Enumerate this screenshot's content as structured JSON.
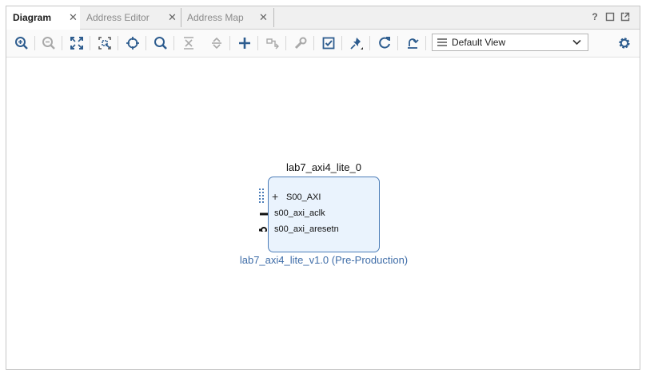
{
  "tabs": [
    {
      "label": "Diagram",
      "active": true
    },
    {
      "label": "Address Editor",
      "active": false
    },
    {
      "label": "Address Map",
      "active": false
    }
  ],
  "window_controls": {
    "help": "?"
  },
  "toolbar": {
    "icons": [
      "zoom-in-icon",
      "zoom-out-icon",
      "fit-view-icon",
      "fit-selection-icon",
      "center-icon",
      "search-icon",
      "collapse-all-icon",
      "expand-all-icon",
      "add-ip-icon",
      "make-connection-icon",
      "wrench-icon",
      "validate-icon",
      "pin-icon",
      "regenerate-icon",
      "optimize-routing-icon",
      "gear-icon"
    ],
    "view_select": "Default View"
  },
  "diagram": {
    "ip_instance_name": "lab7_axi4_lite_0",
    "ip_version": "lab7_axi4_lite_v1.0 (Pre-Production)",
    "ports": [
      {
        "name": "S00_AXI",
        "type": "interface"
      },
      {
        "name": "s00_axi_aclk",
        "type": "clock"
      },
      {
        "name": "s00_axi_aresetn",
        "type": "reset"
      }
    ],
    "colors": {
      "block_fill": "#eaf3fd",
      "block_border": "#4c7db8",
      "version_text": "#3f6da8"
    }
  }
}
